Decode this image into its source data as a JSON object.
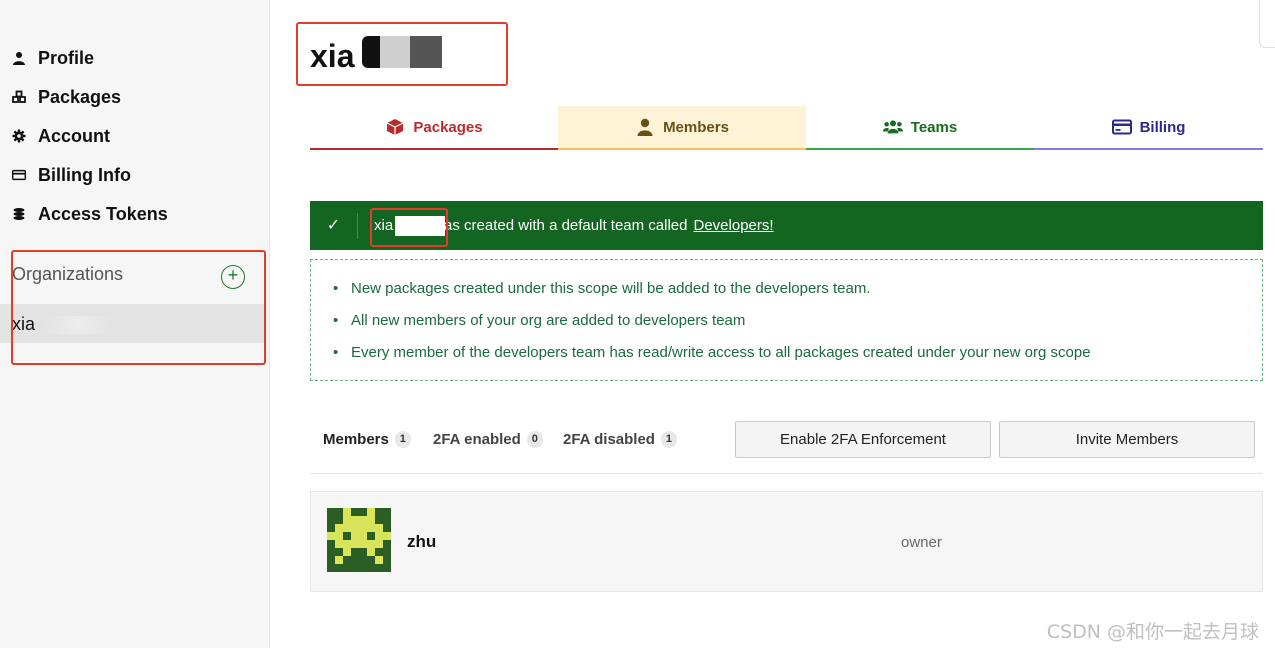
{
  "sidebar": {
    "nav": [
      {
        "label": "Profile",
        "icon": "user-icon"
      },
      {
        "label": "Packages",
        "icon": "packages-icon"
      },
      {
        "label": "Account",
        "icon": "gear-icon"
      },
      {
        "label": "Billing Info",
        "icon": "credit-card-icon"
      },
      {
        "label": "Access Tokens",
        "icon": "tokens-icon"
      }
    ],
    "organizations_title": "Organizations",
    "add_org_symbol": "+",
    "org_name": "xia"
  },
  "header": {
    "org_title": "xia"
  },
  "tabs": [
    {
      "label": "Packages",
      "icon": "package-box-icon",
      "color": "#b92c2c"
    },
    {
      "label": "Members",
      "icon": "member-icon",
      "color": "#6b5213"
    },
    {
      "label": "Teams",
      "icon": "teams-icon",
      "color": "#1a6b20"
    },
    {
      "label": "Billing",
      "icon": "billing-card-icon",
      "color": "#2b2a8c"
    }
  ],
  "banner": {
    "check": "✓",
    "org_text": "xia",
    "message": "was created with a default team called",
    "team_link": "Developers!",
    "color": "#146422"
  },
  "info": {
    "items": [
      "New packages created under this scope will be added to the developers team.",
      "All new members of your org are added to developers team",
      "Every member of the developers team has read/write access to all packages created under your new org scope"
    ]
  },
  "counts": {
    "members_label": "Members",
    "members_count": "1",
    "twofa_enabled_label": "2FA enabled",
    "twofa_enabled_count": "0",
    "twofa_disabled_label": "2FA disabled",
    "twofa_disabled_count": "1"
  },
  "buttons": {
    "enable_2fa": "Enable 2FA Enforcement",
    "invite": "Invite Members"
  },
  "member": {
    "name": "zhu",
    "role": "owner"
  },
  "watermark": "CSDN @和你一起去月球"
}
